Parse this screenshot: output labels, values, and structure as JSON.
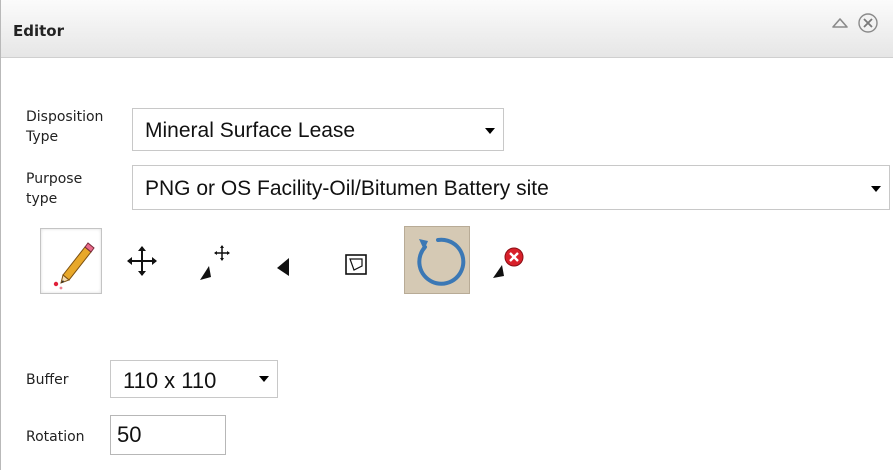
{
  "panel": {
    "title": "Editor",
    "collapse_icon": "collapse-triangle-icon",
    "close_icon": "close-circle-icon"
  },
  "disposition": {
    "label_line1": "Disposition",
    "label_line2": "Type",
    "value": "Mineral Surface Lease"
  },
  "purpose": {
    "label_line1": "Purpose",
    "label_line2": "type",
    "value": "PNG or OS Facility-Oil/Bitumen Battery site"
  },
  "tools": [
    {
      "name": "draw-pencil-tool",
      "icon": "pencil-icon",
      "state": "selected"
    },
    {
      "name": "move-tool",
      "icon": "move-arrows-icon",
      "state": "normal"
    },
    {
      "name": "move-vertex-tool",
      "icon": "vertex-move-icon",
      "state": "normal"
    },
    {
      "name": "select-vertex-tool",
      "icon": "vertex-pointer-icon",
      "state": "normal"
    },
    {
      "name": "reshape-tool",
      "icon": "reshape-square-icon",
      "state": "normal"
    },
    {
      "name": "rotate-tool",
      "icon": "rotate-circle-icon",
      "state": "active"
    },
    {
      "name": "delete-vertex-tool",
      "icon": "delete-vertex-icon",
      "state": "normal"
    }
  ],
  "buffer": {
    "label": "Buffer",
    "value": "110 x 110"
  },
  "rotation": {
    "label": "Rotation",
    "value": "50"
  },
  "colors": {
    "active_tool_bg": "#d5c9b4",
    "rotate_stroke": "#3b78b5",
    "delete_badge": "#d8202a"
  }
}
